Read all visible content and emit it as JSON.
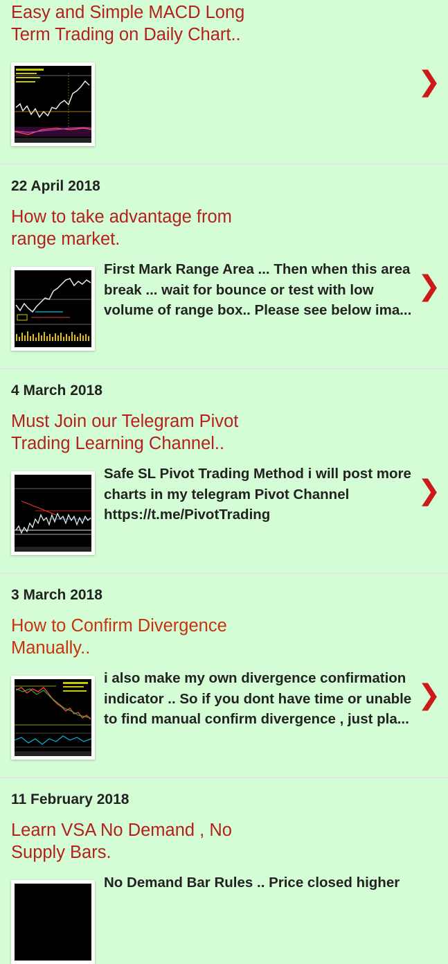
{
  "colors": {
    "background": "#d5fdd5",
    "title": "#b5201f",
    "title_alt": "#c8330f",
    "text": "#222222",
    "arrow": "#cc1a1a"
  },
  "posts": [
    {
      "date": "",
      "title": "Easy and Simple MACD Long Term Trading on Daily Chart..",
      "snippet": "",
      "arrow": "❯",
      "thumbnail_icon": "chart-thumbnail-icon"
    },
    {
      "date": "22 April 2018",
      "title": "How to take advantage from range market.",
      "snippet": "First Mark Range Area ... Then when this area break ... wait for bounce or test with low volume of range box.. Please see below ima...",
      "arrow": "❯",
      "thumbnail_icon": "chart-thumbnail-icon"
    },
    {
      "date": "4 March 2018",
      "title": "Must Join our Telegram Pivot Trading Learning Channel..",
      "snippet": "Safe SL Pivot Trading Method i will post more charts in my telegram Pivot Channel https://t.me/PivotTrading",
      "arrow": "❯",
      "thumbnail_icon": "chart-thumbnail-icon"
    },
    {
      "date": "3 March 2018",
      "title": "How to Confirm Divergence Manually..",
      "snippet": "i also make my own divergence confirmation indicator .. So if you dont have time or unable to find manual confirm divergence , just pla...",
      "arrow": "❯",
      "thumbnail_icon": "chart-thumbnail-icon"
    },
    {
      "date": "11 February 2018",
      "title": "Learn VSA No Demand , No Supply Bars.",
      "snippet": "No Demand Bar Rules .. Price closed higher",
      "arrow": "❯",
      "thumbnail_icon": "chart-thumbnail-icon"
    }
  ]
}
